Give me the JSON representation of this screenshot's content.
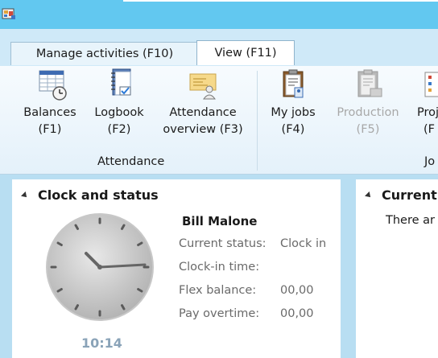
{
  "tabs": [
    {
      "label": "Manage activities (F10)"
    },
    {
      "label": "View (F11)"
    }
  ],
  "ribbon": {
    "buttons": [
      {
        "line1": "Balances",
        "line2": "(F1)",
        "icon": "balances-icon"
      },
      {
        "line1": "Logbook",
        "line2": "(F2)",
        "icon": "logbook-icon"
      },
      {
        "line1": "Attendance",
        "line2": "overview (F3)",
        "icon": "attendance-overview-icon"
      },
      {
        "line1": "My jobs",
        "line2": "(F4)",
        "icon": "my-jobs-icon"
      },
      {
        "line1": "Production",
        "line2": "(F5)",
        "icon": "production-icon",
        "disabled": true
      },
      {
        "line1": "Proj",
        "line2": "(F",
        "icon": "projects-icon"
      }
    ],
    "group_attendance": "Attendance",
    "group_jobs": "Jo"
  },
  "clock_panel": {
    "title": "Clock and status",
    "user_name": "Bill Malone",
    "time": "10:14",
    "fields": [
      {
        "label": "Current status:",
        "value": "Clock in"
      },
      {
        "label": "Clock-in time:",
        "value": ""
      },
      {
        "label": "Flex balance:",
        "value": "00,00"
      },
      {
        "label": "Pay overtime:",
        "value": "00,00"
      }
    ]
  },
  "current_panel": {
    "title": "Current",
    "text": "There ar"
  },
  "colors": {
    "titlebar": "#62c8f0",
    "tab_strip": "#cfe9f8",
    "content_bg": "#b8def2",
    "clock_time": "#8aa3b8"
  }
}
